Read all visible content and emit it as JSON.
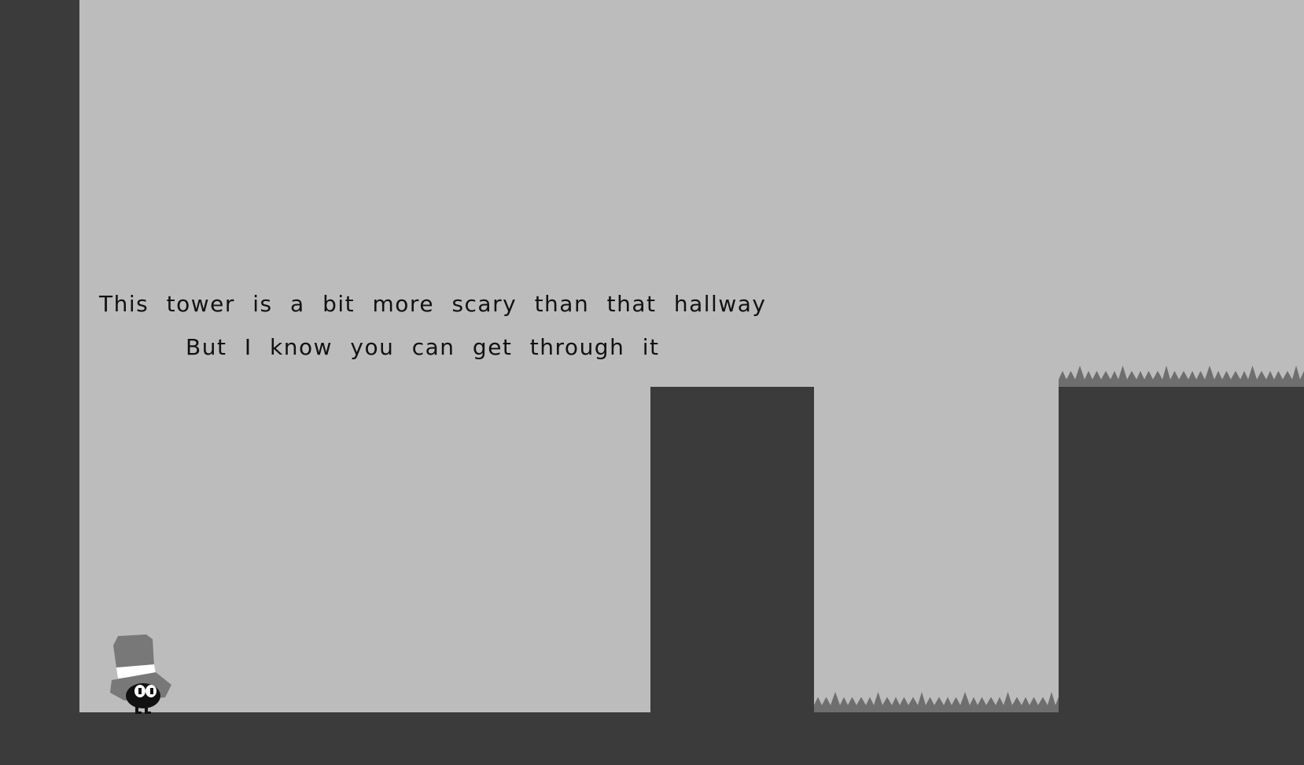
{
  "dialogue": {
    "line1": "This tower is a bit more scary than that hallway",
    "line2": "But I know you can get through it"
  },
  "colors": {
    "sky": "#bcbcbc",
    "solid": "#3b3b3b",
    "spikes": "#6e6e6e",
    "hat": "#787878",
    "hat_band": "#ffffff",
    "player_body": "#111111"
  },
  "player": {
    "icon": "top-hat-character-icon"
  },
  "hazards": {
    "icon": "spike-row-icon"
  }
}
